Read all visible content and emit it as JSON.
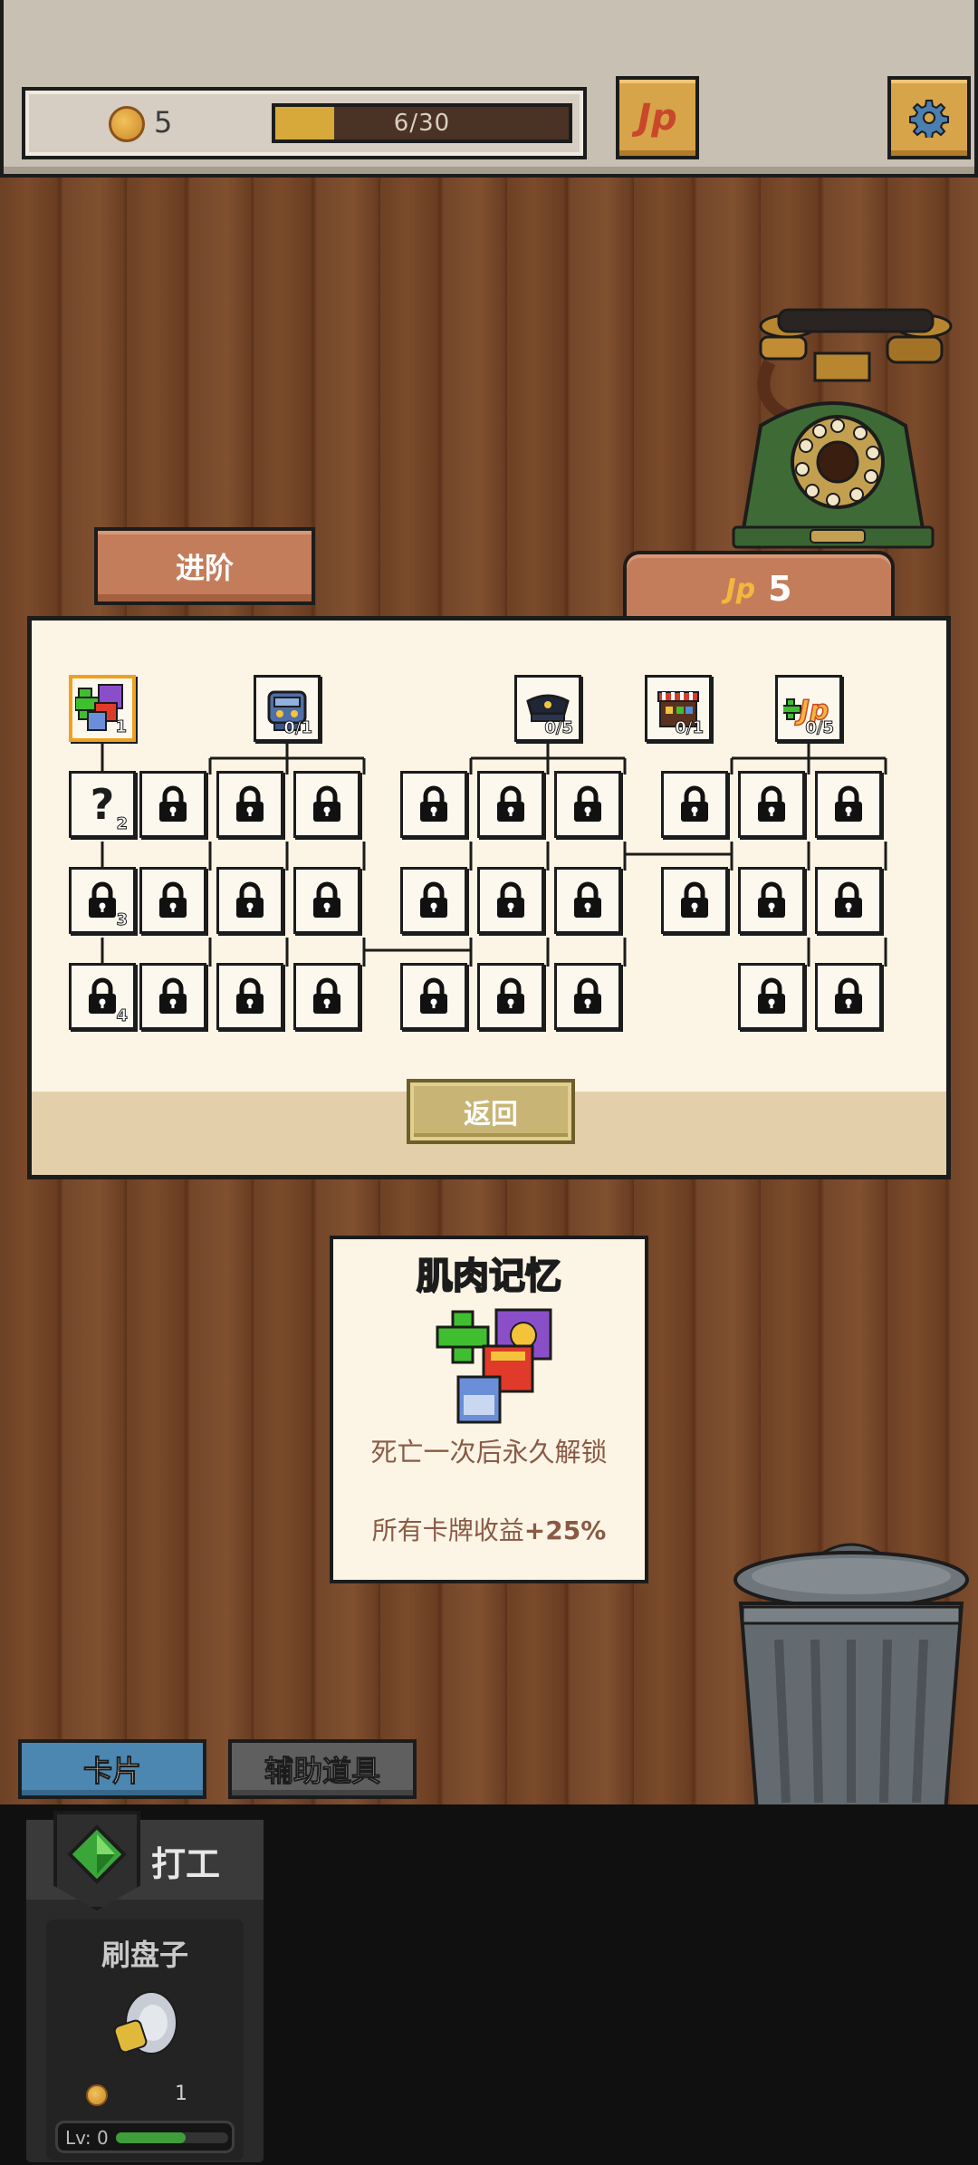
{
  "header": {
    "coins": "5",
    "progress_text": "6/30",
    "progress_value": 0.2,
    "jp_label": "JP",
    "settings_icon": "gear-icon"
  },
  "tabs": {
    "advance_label": "进阶",
    "points_value": "5"
  },
  "tree": {
    "root_counts": [
      "1",
      "0/1",
      "0/5",
      "0/1",
      "0/5"
    ],
    "hidden_node_counts": [
      "2",
      "3",
      "4"
    ],
    "hidden_mark": "?",
    "back_label": "返回"
  },
  "card": {
    "title": "肌肉记忆",
    "unlock_text": "死亡一次后永久解锁",
    "effect_text": "所有卡牌收益",
    "effect_value": "+25%"
  },
  "bottom_tabs": {
    "cards_label": "卡片",
    "tools_label": "辅助道具"
  },
  "job": {
    "category_label": "打工",
    "name": "刷盘子",
    "cost": "1",
    "level_label": "Lv: 0",
    "xp_progress": 0.62
  },
  "colors": {
    "accent_orange": "#c47d5b",
    "panel_bg": "#fcf5e5",
    "gold": "#d6a93a",
    "tab_blue": "#4b87b0"
  }
}
